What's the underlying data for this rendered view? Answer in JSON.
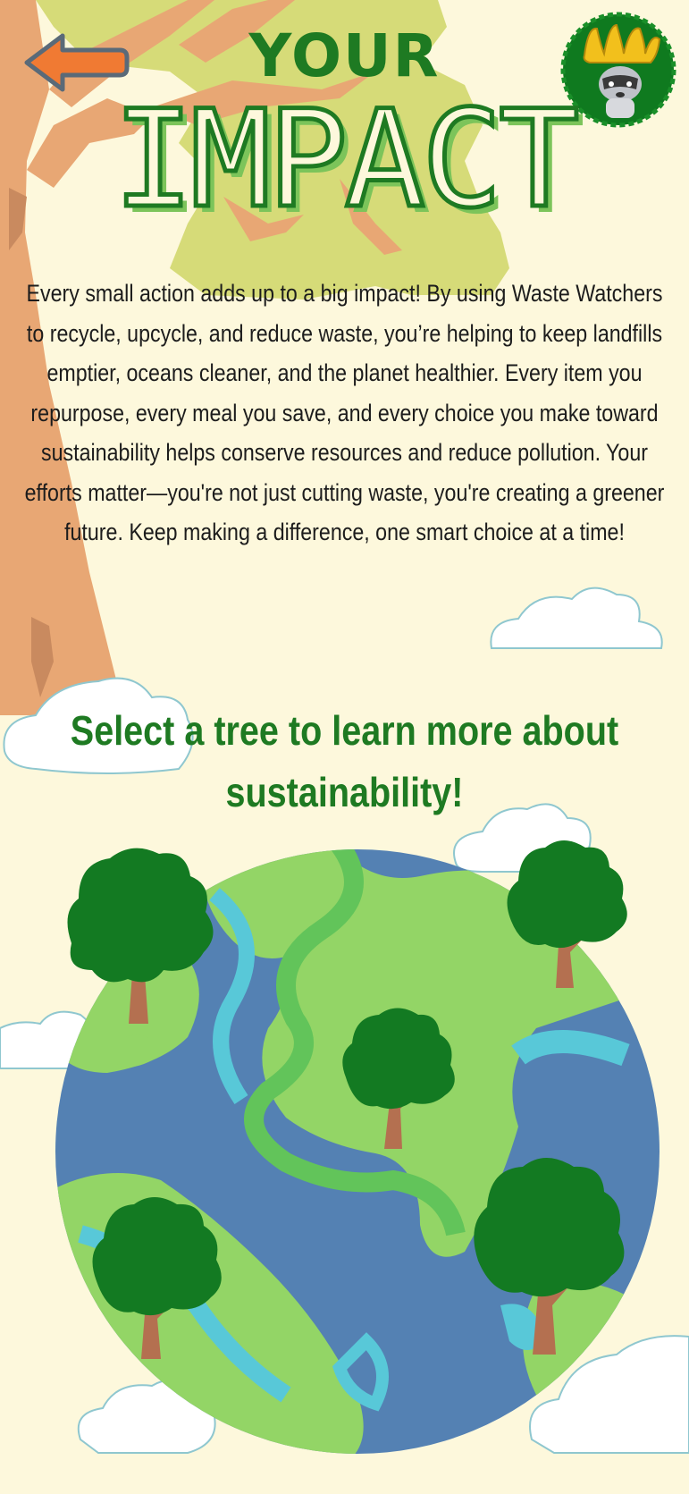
{
  "header": {
    "back_icon": "arrow-left-icon",
    "logo_icon": "raccoon-crown-logo",
    "title_line1": "YOUR",
    "title_line2": "IMPACT"
  },
  "intro_text": "Every small action adds up to a big impact! By using Waste Watchers to recycle, upcycle, and reduce waste, you’re helping to keep landfills emptier, oceans cleaner, and the planet healthier. Every item you repurpose, every meal you save, and every choice you make toward sustainability helps conserve resources and reduce pollution. Your efforts matter—you're not just cutting waste, you're creating a greener future. Keep making a difference, one smart choice at a time!",
  "cta": {
    "line1": "Select a tree to learn more about",
    "line2": "sustainability!"
  },
  "colors": {
    "background": "#fdf8dc",
    "title_green": "#1e7a22",
    "back_arrow": "#f07a33",
    "ocean": "#5481b3",
    "land": "#93d566",
    "tree_foliage": "#137a22",
    "tree_trunk": "#b47050"
  }
}
